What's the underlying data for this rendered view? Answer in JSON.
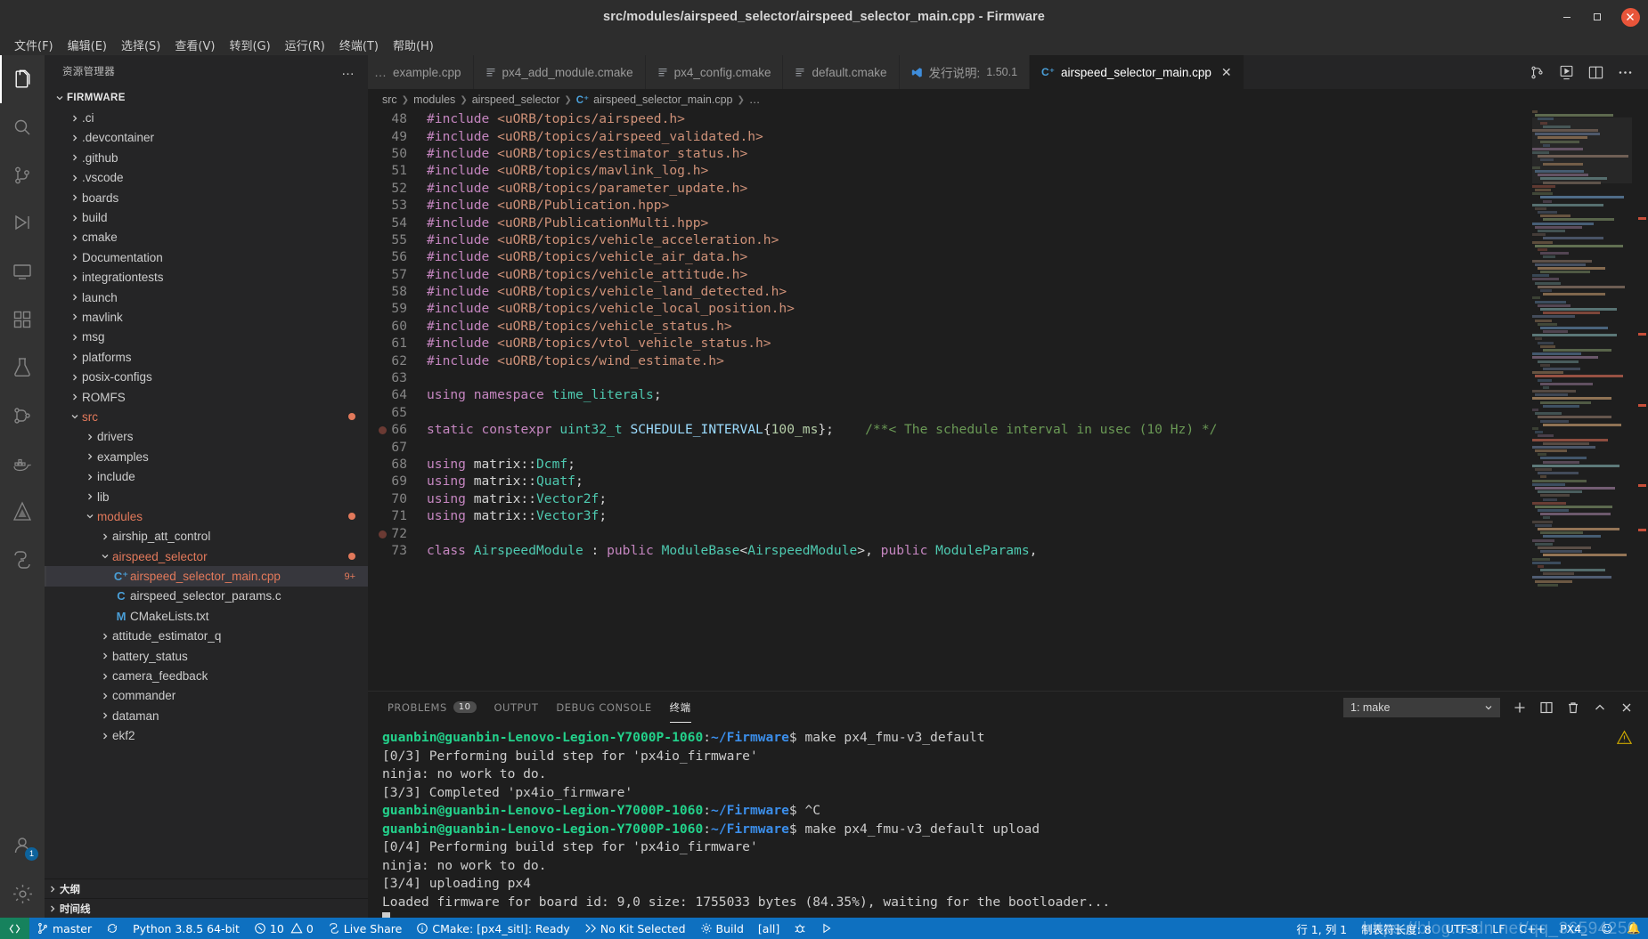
{
  "window": {
    "title": "src/modules/airspeed_selector/airspeed_selector_main.cpp - Firmware",
    "minimize": "–",
    "maximize": "❐",
    "close": "✕"
  },
  "menubar": {
    "items": [
      {
        "label": "文件(F)"
      },
      {
        "label": "编辑(E)"
      },
      {
        "label": "选择(S)"
      },
      {
        "label": "查看(V)"
      },
      {
        "label": "转到(G)"
      },
      {
        "label": "运行(R)"
      },
      {
        "label": "终端(T)"
      },
      {
        "label": "帮助(H)"
      }
    ]
  },
  "activitybar": {
    "items": [
      {
        "name": "explorer",
        "icon": "files-icon",
        "active": true
      },
      {
        "name": "search",
        "icon": "search-icon",
        "active": false
      },
      {
        "name": "source-control",
        "icon": "source-control-icon",
        "active": false
      },
      {
        "name": "run-debug",
        "icon": "run-debug-icon",
        "active": false
      },
      {
        "name": "remote-explorer",
        "icon": "remote-explorer-icon",
        "active": false
      },
      {
        "name": "extensions",
        "icon": "extensions-icon",
        "active": false
      },
      {
        "name": "testing",
        "icon": "beaker-icon",
        "active": false
      },
      {
        "name": "gitlens",
        "icon": "gitlens-icon",
        "active": false
      },
      {
        "name": "docker",
        "icon": "docker-icon",
        "active": false
      },
      {
        "name": "cmake",
        "icon": "cmake-icon",
        "active": false
      },
      {
        "name": "live-share",
        "icon": "live-share-icon",
        "active": false
      }
    ],
    "account_badge": "1",
    "bottom": [
      {
        "name": "accounts",
        "icon": "account-icon"
      },
      {
        "name": "settings",
        "icon": "gear-icon"
      }
    ]
  },
  "sidebar": {
    "title": "资源管理器",
    "more_actions": "…",
    "root": {
      "label": "FIRMWARE",
      "expanded": true
    },
    "tree": [
      {
        "label": ".ci",
        "type": "folder",
        "depth": 1,
        "expanded": false
      },
      {
        "label": ".devcontainer",
        "type": "folder",
        "depth": 1,
        "expanded": false
      },
      {
        "label": ".github",
        "type": "folder",
        "depth": 1,
        "expanded": false
      },
      {
        "label": ".vscode",
        "type": "folder",
        "depth": 1,
        "expanded": false
      },
      {
        "label": "boards",
        "type": "folder",
        "depth": 1,
        "expanded": false
      },
      {
        "label": "build",
        "type": "folder",
        "depth": 1,
        "expanded": false
      },
      {
        "label": "cmake",
        "type": "folder",
        "depth": 1,
        "expanded": false
      },
      {
        "label": "Documentation",
        "type": "folder",
        "depth": 1,
        "expanded": false
      },
      {
        "label": "integrationtests",
        "type": "folder",
        "depth": 1,
        "expanded": false
      },
      {
        "label": "launch",
        "type": "folder",
        "depth": 1,
        "expanded": false
      },
      {
        "label": "mavlink",
        "type": "folder",
        "depth": 1,
        "expanded": false
      },
      {
        "label": "msg",
        "type": "folder",
        "depth": 1,
        "expanded": false
      },
      {
        "label": "platforms",
        "type": "folder",
        "depth": 1,
        "expanded": false
      },
      {
        "label": "posix-configs",
        "type": "folder",
        "depth": 1,
        "expanded": false
      },
      {
        "label": "ROMFS",
        "type": "folder",
        "depth": 1,
        "expanded": false
      },
      {
        "label": "src",
        "type": "folder",
        "depth": 1,
        "expanded": true,
        "modified": true,
        "badge_dot": true
      },
      {
        "label": "drivers",
        "type": "folder",
        "depth": 2,
        "expanded": false
      },
      {
        "label": "examples",
        "type": "folder",
        "depth": 2,
        "expanded": false
      },
      {
        "label": "include",
        "type": "folder",
        "depth": 2,
        "expanded": false
      },
      {
        "label": "lib",
        "type": "folder",
        "depth": 2,
        "expanded": false
      },
      {
        "label": "modules",
        "type": "folder",
        "depth": 2,
        "expanded": true,
        "modified": true,
        "badge_dot": true
      },
      {
        "label": "airship_att_control",
        "type": "folder",
        "depth": 3,
        "expanded": false
      },
      {
        "label": "airspeed_selector",
        "type": "folder",
        "depth": 3,
        "expanded": true,
        "modified": true,
        "badge_dot": true
      },
      {
        "label": "airspeed_selector_main.cpp",
        "type": "file",
        "depth": 4,
        "icon": "cpp",
        "icon_glyph": "C⁺",
        "modified": true,
        "selected": true,
        "badge": "9+"
      },
      {
        "label": "airspeed_selector_params.c",
        "type": "file",
        "depth": 4,
        "icon": "c",
        "icon_glyph": "C"
      },
      {
        "label": "CMakeLists.txt",
        "type": "file",
        "depth": 4,
        "icon": "m",
        "icon_glyph": "M"
      },
      {
        "label": "attitude_estimator_q",
        "type": "folder",
        "depth": 3,
        "expanded": false
      },
      {
        "label": "battery_status",
        "type": "folder",
        "depth": 3,
        "expanded": false
      },
      {
        "label": "camera_feedback",
        "type": "folder",
        "depth": 3,
        "expanded": false
      },
      {
        "label": "commander",
        "type": "folder",
        "depth": 3,
        "expanded": false
      },
      {
        "label": "dataman",
        "type": "folder",
        "depth": 3,
        "expanded": false
      },
      {
        "label": "ekf2",
        "type": "folder",
        "depth": 3,
        "expanded": false
      }
    ],
    "sections": [
      {
        "label": "大纲"
      },
      {
        "label": "时间线"
      }
    ]
  },
  "editor": {
    "tabs_overflow": "…",
    "tabs": [
      {
        "label": "example.cpp",
        "icon": "cpp-file-icon",
        "active": false,
        "clipped": true
      },
      {
        "label": "px4_add_module.cmake",
        "icon": "cmake-file-icon",
        "active": false
      },
      {
        "label": "px4_config.cmake",
        "icon": "cmake-file-icon",
        "active": false
      },
      {
        "label": "default.cmake",
        "icon": "cmake-file-icon",
        "active": false
      },
      {
        "label": "发行说明:",
        "version": "1.50.1",
        "icon": "vscode-icon",
        "active": false
      },
      {
        "label": "airspeed_selector_main.cpp",
        "icon": "cpp-file-icon",
        "active": true,
        "close": "✕"
      }
    ],
    "actions": [
      {
        "name": "split-in-group-icon"
      },
      {
        "name": "run-icon"
      },
      {
        "name": "split-editor-icon"
      },
      {
        "name": "more-actions-icon"
      }
    ],
    "breadcrumb": [
      "src",
      "modules",
      "airspeed_selector",
      "airspeed_selector_main.cpp",
      "…"
    ],
    "first_line": 48,
    "lines": [
      {
        "n": 48,
        "tokens": [
          [
            "t-pre",
            "#include "
          ],
          [
            "t-str",
            "<uORB/topics/airspeed.h>"
          ]
        ]
      },
      {
        "n": 49,
        "tokens": [
          [
            "t-pre",
            "#include "
          ],
          [
            "t-str",
            "<uORB/topics/airspeed_validated.h>"
          ]
        ]
      },
      {
        "n": 50,
        "tokens": [
          [
            "t-pre",
            "#include "
          ],
          [
            "t-str",
            "<uORB/topics/estimator_status.h>"
          ]
        ]
      },
      {
        "n": 51,
        "tokens": [
          [
            "t-pre",
            "#include "
          ],
          [
            "t-str",
            "<uORB/topics/mavlink_log.h>"
          ]
        ]
      },
      {
        "n": 52,
        "tokens": [
          [
            "t-pre",
            "#include "
          ],
          [
            "t-str",
            "<uORB/topics/parameter_update.h>"
          ]
        ]
      },
      {
        "n": 53,
        "tokens": [
          [
            "t-pre",
            "#include "
          ],
          [
            "t-str",
            "<uORB/Publication.hpp>"
          ]
        ]
      },
      {
        "n": 54,
        "tokens": [
          [
            "t-pre",
            "#include "
          ],
          [
            "t-str",
            "<uORB/PublicationMulti.hpp>"
          ]
        ]
      },
      {
        "n": 55,
        "tokens": [
          [
            "t-pre",
            "#include "
          ],
          [
            "t-str",
            "<uORB/topics/vehicle_acceleration.h>"
          ]
        ]
      },
      {
        "n": 56,
        "tokens": [
          [
            "t-pre",
            "#include "
          ],
          [
            "t-str",
            "<uORB/topics/vehicle_air_data.h>"
          ]
        ]
      },
      {
        "n": 57,
        "tokens": [
          [
            "t-pre",
            "#include "
          ],
          [
            "t-str",
            "<uORB/topics/vehicle_attitude.h>"
          ]
        ]
      },
      {
        "n": 58,
        "tokens": [
          [
            "t-pre",
            "#include "
          ],
          [
            "t-str",
            "<uORB/topics/vehicle_land_detected.h>"
          ]
        ]
      },
      {
        "n": 59,
        "tokens": [
          [
            "t-pre",
            "#include "
          ],
          [
            "t-str",
            "<uORB/topics/vehicle_local_position.h>"
          ]
        ]
      },
      {
        "n": 60,
        "tokens": [
          [
            "t-pre",
            "#include "
          ],
          [
            "t-str",
            "<uORB/topics/vehicle_status.h>"
          ]
        ]
      },
      {
        "n": 61,
        "tokens": [
          [
            "t-pre",
            "#include "
          ],
          [
            "t-str",
            "<uORB/topics/vtol_vehicle_status.h>"
          ]
        ]
      },
      {
        "n": 62,
        "tokens": [
          [
            "t-pre",
            "#include "
          ],
          [
            "t-str",
            "<uORB/topics/wind_estimate.h>"
          ]
        ]
      },
      {
        "n": 63,
        "tokens": []
      },
      {
        "n": 64,
        "tokens": [
          [
            "t-kw",
            "using "
          ],
          [
            "t-kw",
            "namespace "
          ],
          [
            "t-ns",
            "time_literals"
          ],
          [
            "t-punc",
            ";"
          ]
        ]
      },
      {
        "n": 65,
        "tokens": []
      },
      {
        "n": 66,
        "breakpoint": true,
        "tokens": [
          [
            "t-kw",
            "static "
          ],
          [
            "t-kw",
            "constexpr "
          ],
          [
            "t-type",
            "uint32_t "
          ],
          [
            "t-var",
            "SCHEDULE_INTERVAL"
          ],
          [
            "t-punc",
            "{"
          ],
          [
            "t-num",
            "100_ms"
          ],
          [
            "t-punc",
            "};"
          ],
          [
            "t-plain",
            "    "
          ],
          [
            "t-cmt",
            "/**< The schedule interval in usec (10 Hz) */"
          ]
        ]
      },
      {
        "n": 67,
        "tokens": []
      },
      {
        "n": 68,
        "tokens": [
          [
            "t-kw",
            "using "
          ],
          [
            "t-plain",
            "matrix::"
          ],
          [
            "t-type",
            "Dcmf"
          ],
          [
            "t-punc",
            ";"
          ]
        ]
      },
      {
        "n": 69,
        "tokens": [
          [
            "t-kw",
            "using "
          ],
          [
            "t-plain",
            "matrix::"
          ],
          [
            "t-type",
            "Quatf"
          ],
          [
            "t-punc",
            ";"
          ]
        ]
      },
      {
        "n": 70,
        "tokens": [
          [
            "t-kw",
            "using "
          ],
          [
            "t-plain",
            "matrix::"
          ],
          [
            "t-type",
            "Vector2f"
          ],
          [
            "t-punc",
            ";"
          ]
        ]
      },
      {
        "n": 71,
        "tokens": [
          [
            "t-kw",
            "using "
          ],
          [
            "t-plain",
            "matrix::"
          ],
          [
            "t-type",
            "Vector3f"
          ],
          [
            "t-punc",
            ";"
          ]
        ]
      },
      {
        "n": 72,
        "breakpoint": true,
        "tokens": []
      },
      {
        "n": 73,
        "tokens": [
          [
            "t-kw",
            "class "
          ],
          [
            "t-cls",
            "AirspeedModule "
          ],
          [
            "t-punc",
            ": "
          ],
          [
            "t-kw",
            "public "
          ],
          [
            "t-cls",
            "ModuleBase"
          ],
          [
            "t-punc",
            "<"
          ],
          [
            "t-cls",
            "AirspeedModule"
          ],
          [
            "t-punc",
            ">, "
          ],
          [
            "t-kw",
            "public "
          ],
          [
            "t-cls",
            "ModuleParams"
          ],
          [
            "t-punc",
            ","
          ]
        ]
      }
    ]
  },
  "panel": {
    "tabs": [
      {
        "label": "PROBLEMS",
        "badge": "10",
        "active": false
      },
      {
        "label": "OUTPUT",
        "active": false
      },
      {
        "label": "DEBUG CONSOLE",
        "active": false
      },
      {
        "label": "终端",
        "active": true
      }
    ],
    "terminal_select": "1: make",
    "select_caret": "⌄",
    "actions": [
      {
        "name": "new-terminal-icon",
        "glyph": "＋"
      },
      {
        "name": "split-terminal-icon",
        "glyph": "◫"
      },
      {
        "name": "kill-terminal-icon",
        "glyph": "🗑"
      },
      {
        "name": "maximize-panel-icon",
        "glyph": "∧"
      },
      {
        "name": "close-panel-icon",
        "glyph": "✕"
      }
    ],
    "warning_icon": "⚠",
    "terminal": {
      "prompt_user": "guanbin@guanbin-Lenovo-Legion-Y7000P-1060",
      "prompt_sep": ":",
      "prompt_path": "~/Firmware",
      "prompt_tail": "$ ",
      "lines": [
        {
          "type": "prompt",
          "command": "make px4_fmu-v3_default"
        },
        {
          "type": "out",
          "text": "[0/3] Performing build step for 'px4io_firmware'"
        },
        {
          "type": "out",
          "text": "ninja: no work to do."
        },
        {
          "type": "out",
          "text": "[3/3] Completed 'px4io_firmware'"
        },
        {
          "type": "prompt",
          "command": "^C"
        },
        {
          "type": "prompt",
          "command": "make px4_fmu-v3_default upload"
        },
        {
          "type": "out",
          "text": "[0/4] Performing build step for 'px4io_firmware'"
        },
        {
          "type": "out",
          "text": "ninja: no work to do."
        },
        {
          "type": "out",
          "text": "[3/4] uploading px4"
        },
        {
          "type": "out",
          "text": "Loaded firmware for board id: 9,0 size: 1755033 bytes (84.35%), waiting for the bootloader..."
        },
        {
          "type": "cursor"
        }
      ]
    }
  },
  "statusbar": {
    "left": [
      {
        "name": "remote-indicator",
        "icon": "remote-icon",
        "label": "",
        "remote": true
      },
      {
        "name": "branch",
        "icon": "git-branch-icon",
        "label": "master"
      },
      {
        "name": "sync",
        "icon": "sync-icon",
        "label": ""
      },
      {
        "name": "python-version",
        "icon": "",
        "label": "Python 3.8.5 64-bit"
      },
      {
        "name": "problems",
        "icon": "error-icon",
        "label": "10",
        "icon2": "warning-icon",
        "label2": "0"
      },
      {
        "name": "live-share",
        "icon": "live-share-icon",
        "label": "Live Share"
      },
      {
        "name": "cmake-status",
        "icon": "info-icon",
        "label": "CMake: [px4_sitl]: Ready"
      },
      {
        "name": "kit-selector",
        "icon": "tools-icon",
        "label": "No Kit Selected"
      },
      {
        "name": "build",
        "icon": "gear-icon",
        "label": "Build"
      },
      {
        "name": "build-target",
        "icon": "",
        "label": "[all]"
      },
      {
        "name": "debug-config",
        "icon": "bug-icon",
        "label": ""
      },
      {
        "name": "launch",
        "icon": "play-icon",
        "label": ""
      }
    ],
    "right": [
      {
        "name": "cursor-position",
        "label": "行 1, 列 1"
      },
      {
        "name": "tab-size",
        "label": "制表符长度: 8"
      },
      {
        "name": "encoding",
        "label": "UTF-8"
      },
      {
        "name": "eol",
        "label": "LF"
      },
      {
        "name": "language-mode",
        "label": "C++"
      },
      {
        "name": "cmake-target",
        "label": "PX4_"
      },
      {
        "name": "feedback",
        "label": "☺"
      },
      {
        "name": "notifications",
        "label": "🔔"
      }
    ]
  },
  "watermark": "https://blog.csdn.net/qq_36594250"
}
